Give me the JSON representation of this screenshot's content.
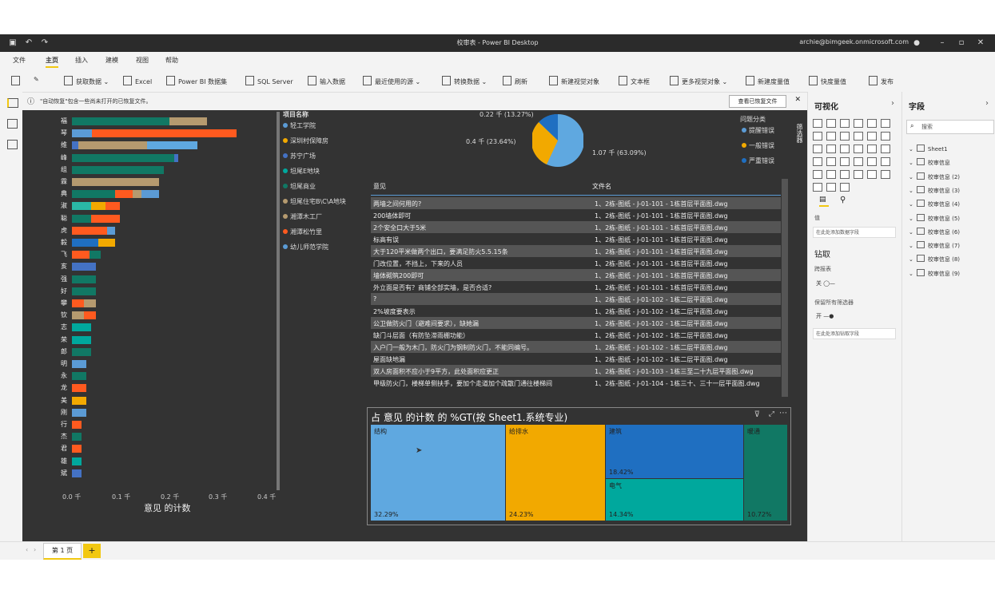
{
  "window": {
    "title": "校审表 - Power BI Desktop",
    "user": "archie@bimgeek.onmicrosoft.com"
  },
  "menu": [
    "文件",
    "主页",
    "插入",
    "建模",
    "视图",
    "帮助"
  ],
  "ribbon": [
    "获取数据",
    "Excel",
    "Power BI 数据集",
    "SQL Server",
    "输入数据",
    "最近使用的源",
    "转换数据",
    "刷新",
    "新建视觉对象",
    "文本框",
    "更多视觉对象",
    "新建度量值",
    "快度量值",
    "发布"
  ],
  "infobar": {
    "message": "\"自动恢复\"包含一些尚未打开的已恢复文件。",
    "button": "查看已恢复文件"
  },
  "bar_chart": {
    "categories": [
      "福",
      "琴",
      "维",
      "峰",
      "组",
      "霖",
      "典",
      "淑",
      "聪",
      "虎",
      "毅",
      "飞",
      "亥",
      "强",
      "好",
      "攀",
      "钦",
      "志",
      "荣",
      "郎",
      "明",
      "永",
      "龙",
      "美",
      "刚",
      "行",
      "杰",
      "君",
      "雄",
      "斌"
    ],
    "xticks": [
      "0.0 千",
      "0.1 千",
      "0.2 千",
      "0.3 千",
      "0.4 千"
    ],
    "xlabel": "意见 的计数"
  },
  "chart_data": {
    "type": "bar",
    "orientation": "horizontal",
    "categories": [
      "福",
      "琴",
      "维",
      "峰",
      "组",
      "霖",
      "典",
      "淑",
      "聪",
      "虎",
      "毅",
      "飞",
      "亥",
      "强",
      "好",
      "攀",
      "钦",
      "志",
      "荣",
      "郎",
      "明",
      "永",
      "龙",
      "美",
      "刚",
      "行",
      "杰",
      "君",
      "雄",
      "斌"
    ],
    "series": [
      {
        "color": "#2ab7a6",
        "values": [
          0.28,
          0.34,
          0.26,
          0.22,
          0.19,
          0.18,
          0.18,
          0.1,
          0.1,
          0.09,
          0.09,
          0.06,
          0.05,
          0.05,
          0.05,
          0.05,
          0.05,
          0.04,
          0.04,
          0.04,
          0.03,
          0.03,
          0.03,
          0.03,
          0.03,
          0.02,
          0.02,
          0.02,
          0.02,
          0.02
        ]
      }
    ],
    "xlim": [
      0,
      0.4
    ],
    "xlabel": "意见 的计数"
  },
  "legend_list": {
    "title": "项目名称",
    "items": [
      {
        "label": "轻工学院",
        "color": "#5b9bd5"
      },
      {
        "label": "深圳村保障房",
        "color": "#f2a900"
      },
      {
        "label": "苏宁广场",
        "color": "#4472c4"
      },
      {
        "label": "坦尾E地块",
        "color": "#00a89d"
      },
      {
        "label": "坦尾商业",
        "color": "#117864"
      },
      {
        "label": "坦尾住宅B\\C\\A地块",
        "color": "#b59a6f"
      },
      {
        "label": "湘潭木工厂",
        "color": "#b59a6f"
      },
      {
        "label": "湘潭松竹里",
        "color": "#ff5a1f"
      },
      {
        "label": "幼儿师范学院",
        "color": "#5b9bd5"
      }
    ]
  },
  "pie": {
    "labels": [
      "0.22 千 (13.27%)",
      "0.4 千 (23.64%)",
      "1.07 千 (63.09%)"
    ],
    "legend_title": "问题分类",
    "legend": [
      {
        "label": "提醒错误",
        "color": "#5b9bd5"
      },
      {
        "label": "一般错误",
        "color": "#f2a900"
      },
      {
        "label": "严重错误",
        "color": "#1f6fc1"
      }
    ]
  },
  "table": {
    "headers": [
      "意见",
      "文件名"
    ],
    "rows": [
      [
        "两墙之间何用的?",
        "1、2栋-图纸 - J-01-101 - 1栋首层平面图.dwg"
      ],
      [
        "200墙体即可",
        "1、2栋-图纸 - J-01-101 - 1栋首层平面图.dwg"
      ],
      [
        "2个安全口大于5米",
        "1、2栋-图纸 - J-01-101 - 1栋首层平面图.dwg"
      ],
      [
        "标高有误",
        "1、2栋-图纸 - J-01-101 - 1栋首层平面图.dwg"
      ],
      [
        "大于120平米做两个出口，要满足防火5.5.15条",
        "1、2栋-图纸 - J-01-101 - 1栋首层平面图.dwg"
      ],
      [
        "门改位置，不挡上，下来的人员",
        "1、2栋-图纸 - J-01-101 - 1栋首层平面图.dwg"
      ],
      [
        "墙体砌筑200即可",
        "1、2栋-图纸 - J-01-101 - 1栋首层平面图.dwg"
      ],
      [
        "外立面是否有？商铺全部实墙，是否合适?",
        "1、2栋-图纸 - J-01-101 - 1栋首层平面图.dwg"
      ],
      [
        "?",
        "1、2栋-图纸 - J-01-102 - 1栋二层平面图.dwg"
      ],
      [
        "2%坡度要表示",
        "1、2栋-图纸 - J-01-102 - 1栋二层平面图.dwg"
      ],
      [
        "公卫做防火门（避难间要求），缺她漏",
        "1、2栋-图纸 - J-01-102 - 1栋二层平面图.dwg"
      ],
      [
        "缺门斗层面（有防坠滞雨棚功能）",
        "1、2栋-图纸 - J-01-102 - 1栋二层平面图.dwg"
      ],
      [
        "入户门一般为木门，防火门为钢制防火门，不能同编号。",
        "1、2栋-图纸 - J-01-102 - 1栋二层平面图.dwg"
      ],
      [
        "屋面缺地漏",
        "1、2栋-图纸 - J-01-102 - 1栋二层平面图.dwg"
      ],
      [
        "双人房面积不应小于9平方，此处面积应更正",
        "1、2栋-图纸 - J-01-103 - 1栋三至二十九层平面图.dwg"
      ],
      [
        "甲级防火门，楼梯单侧扶手，要加个走道加个疏散门通往楼梯间",
        "1、2栋-图纸 - J-01-104 - 1栋三十、三十一层平面图.dwg"
      ]
    ]
  },
  "treemap": {
    "title": "占 意见 的计数 的 %GT(按 Sheet1.系统专业)",
    "cells": [
      {
        "label": "结构",
        "pct": "32.29%",
        "color": "#5fa8e0"
      },
      {
        "label": "给排水",
        "pct": "24.23%",
        "color": "#f2a900"
      },
      {
        "label": "建筑",
        "pct": "18.42%",
        "color": "#1f6fc1"
      },
      {
        "label": "电气",
        "pct": "14.34%",
        "color": "#00a89d"
      },
      {
        "label": "暖通",
        "pct": "10.72%",
        "color": "#117864"
      }
    ]
  },
  "filter_pane": {
    "label": "筛选器"
  },
  "viz_pane": {
    "title": "可视化",
    "values_label": "值",
    "values_placeholder": "在此处添加数据字段",
    "drill_title": "钻取",
    "cross_report": "跨报表",
    "cross_state": "关",
    "keep_filters": "保留所有筛选器",
    "keep_state": "开",
    "drill_placeholder": "在此处添加钻取字段"
  },
  "fields_pane": {
    "title": "字段",
    "search_placeholder": "搜索",
    "tables": [
      "Sheet1",
      "校审信息",
      "校审信息 (2)",
      "校审信息 (3)",
      "校审信息 (4)",
      "校审信息 (5)",
      "校审信息 (6)",
      "校审信息 (7)",
      "校审信息 (8)",
      "校审信息 (9)"
    ]
  },
  "status": {
    "page_tab": "第 1 页",
    "add_page": "+"
  }
}
